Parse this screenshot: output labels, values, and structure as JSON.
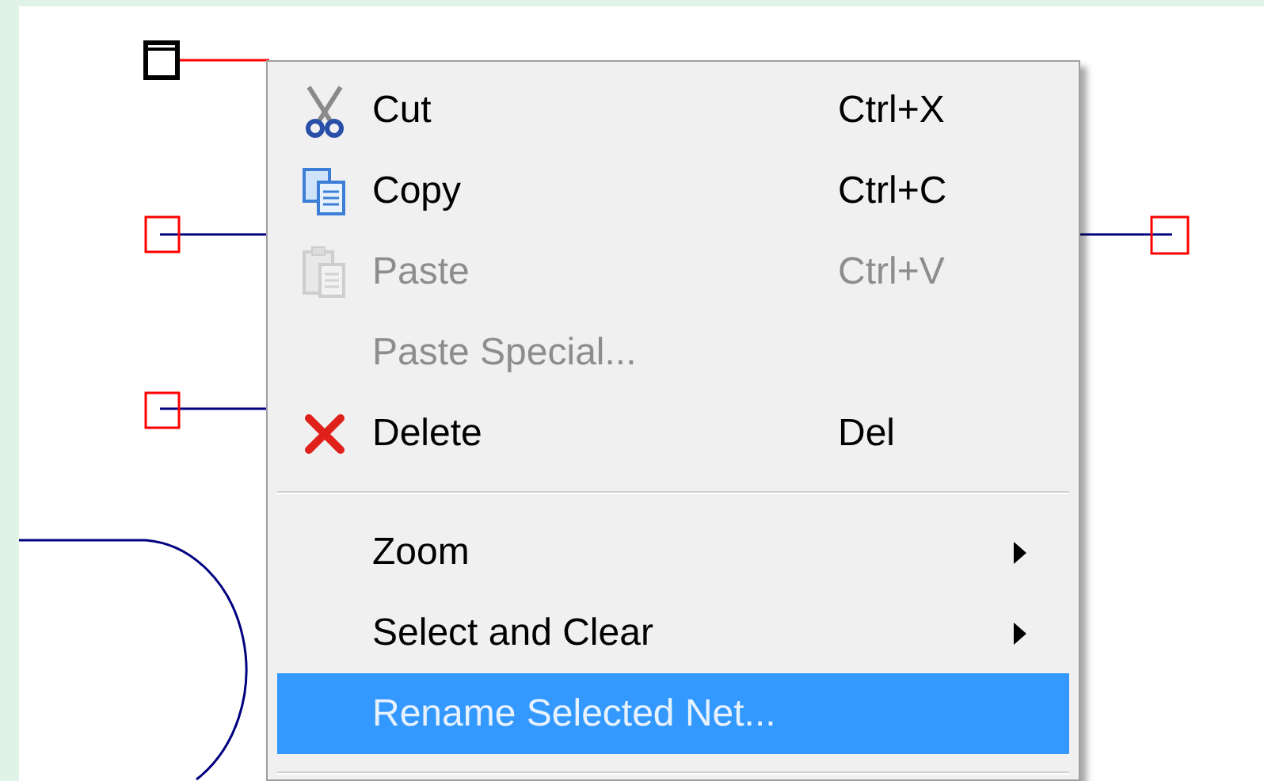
{
  "context_menu": {
    "items": [
      {
        "kind": "item",
        "label": "Cut",
        "shortcut": "Ctrl+X",
        "disabled": false,
        "selected": false,
        "submenu": false
      },
      {
        "kind": "item",
        "label": "Copy",
        "shortcut": "Ctrl+C",
        "disabled": false,
        "selected": false,
        "submenu": false
      },
      {
        "kind": "item",
        "label": "Paste",
        "shortcut": "Ctrl+V",
        "disabled": true,
        "selected": false,
        "submenu": false
      },
      {
        "kind": "item",
        "label": "Paste Special...",
        "disabled": true,
        "selected": false,
        "submenu": false
      },
      {
        "kind": "item",
        "label": "Delete",
        "shortcut": "Del",
        "disabled": false,
        "selected": false,
        "submenu": false
      },
      {
        "kind": "separator"
      },
      {
        "kind": "item",
        "label": "Zoom",
        "disabled": false,
        "selected": false,
        "submenu": true
      },
      {
        "kind": "item",
        "label": "Select and Clear",
        "disabled": false,
        "selected": false,
        "submenu": true
      },
      {
        "kind": "item",
        "label": "Rename Selected Net...",
        "disabled": false,
        "selected": true,
        "submenu": false
      },
      {
        "kind": "separator"
      }
    ]
  }
}
